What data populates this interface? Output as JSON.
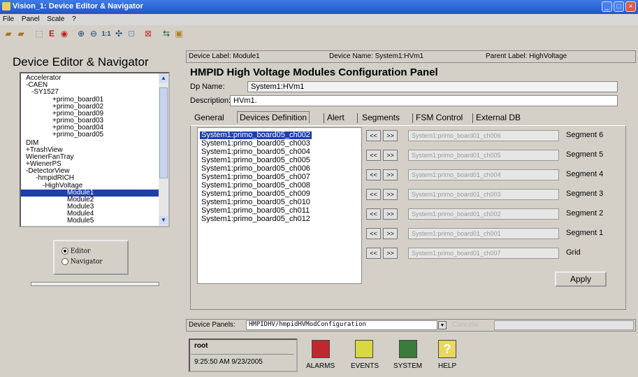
{
  "window": {
    "title": "Vision_1: Device Editor & Navigator"
  },
  "menu": [
    "File",
    "Panel",
    "Scale",
    "?"
  ],
  "left_panel": {
    "title": "Device Editor & Navigator",
    "tree": [
      "Accelerator",
      "-CAEN",
      "-SY1527",
      "+primo_board01",
      "+primo_board02",
      "+primo_board09",
      "+primo_board03",
      "+primo_board04",
      "+primo_board05",
      "DIM",
      "+TrashView",
      "WienerFanTray",
      "+WienerPS",
      "-DetectorView",
      "-hmpidRICH",
      "-HighVoltage",
      "Module1",
      "Module2",
      "Module3",
      "Module4",
      "Module5"
    ],
    "selected_tree_item": "Module1",
    "modes": [
      "Editor",
      "Navigator"
    ],
    "selected_mode": "Editor"
  },
  "info_bar": {
    "device_label": "Device Label: Module1",
    "device_name": "Device Name: System1:HVm1",
    "parent_label": "Parent Label: HighVoltage"
  },
  "panel_title": "HMPID High Voltage Modules Configuration Panel",
  "dp_name": {
    "label": "Dp Name:",
    "value": "System1:HVm1"
  },
  "description": {
    "label": "Description:",
    "value": "HVm1."
  },
  "tabs": [
    "General",
    "Devices Definition",
    "Alert",
    "Segments",
    "FSM Control",
    "External DB"
  ],
  "active_tab": "Devices Definition",
  "channels": [
    "System1:primo_board05_ch002",
    "System1:primo_board05_ch003",
    "System1:primo_board05_ch004",
    "System1:primo_board05_ch005",
    "System1:primo_board05_ch006",
    "System1:primo_board05_ch007",
    "System1:primo_board05_ch008",
    "System1:primo_board05_ch009",
    "System1:primo_board05_ch010",
    "System1:primo_board05_ch011",
    "System1:primo_board05_ch012"
  ],
  "selected_channel": "System1:primo_board05_ch002",
  "move_left_label": "<<",
  "move_right_label": ">>",
  "segments": [
    {
      "value": "System1:primo_board01_ch006",
      "label": "Segment 6"
    },
    {
      "value": "System1:primo_board01_ch005",
      "label": "Segment 5"
    },
    {
      "value": "System1:primo_board01_ch004",
      "label": "Segment 4"
    },
    {
      "value": "System1:primo_board01_ch003",
      "label": "Segment 3"
    },
    {
      "value": "System1:primo_board01_ch002",
      "label": "Segment 2"
    },
    {
      "value": "System1:primo_board01_ch001",
      "label": "Segment 1"
    },
    {
      "value": "System1:primo_board01_ch007",
      "label": "Grid"
    }
  ],
  "apply_label": "Apply",
  "device_panels": {
    "label": "Device Panels:",
    "value": "HMPIDHV/hmpidHVModConfiguration",
    "disabled_label": "Cancela"
  },
  "status": {
    "user": "root",
    "datetime": "9:25:50 AM  9/23/2005"
  },
  "bottom_buttons": [
    {
      "label": "ALARMS",
      "icon": "alarm-icon",
      "color": "#c0282d"
    },
    {
      "label": "EVENTS",
      "icon": "events-icon",
      "color": "#d8d840"
    },
    {
      "label": "SYSTEM",
      "icon": "system-icon",
      "color": "#3a7a3a"
    },
    {
      "label": "HELP",
      "icon": "help-icon",
      "color": "#e8d860"
    }
  ]
}
